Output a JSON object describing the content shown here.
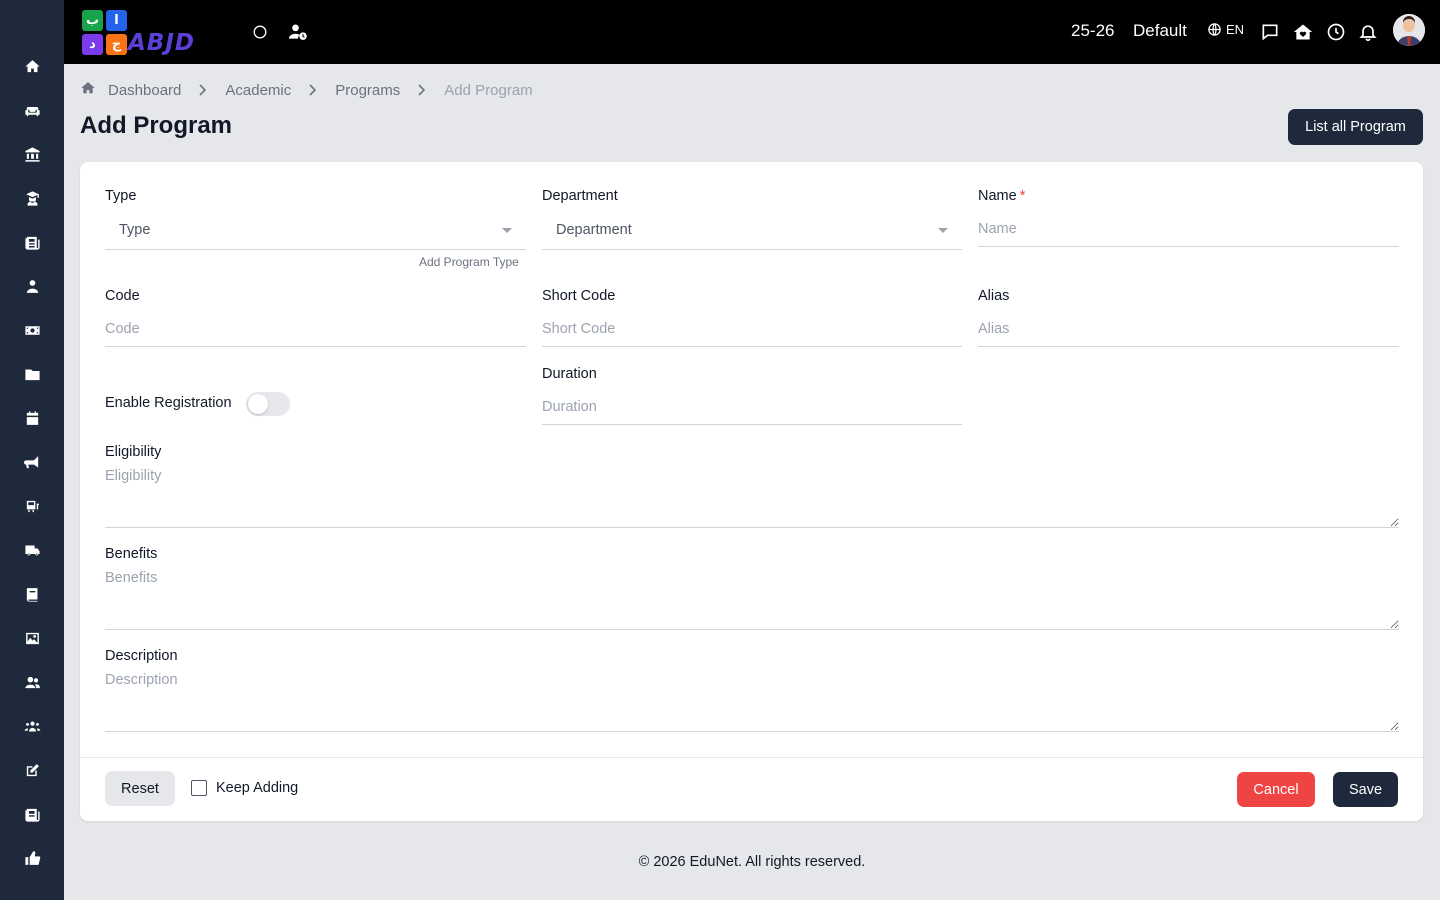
{
  "topbar": {
    "logo_word": "ABJD",
    "logo_tiles": [
      "ب",
      "ا",
      "ج",
      "د"
    ],
    "session": "25-26",
    "theme": "Default",
    "language": "EN",
    "icons": [
      "circle-icon",
      "user-clock-icon",
      "globe-icon",
      "chat-icon",
      "home-heart-icon",
      "clock-icon",
      "bell-icon"
    ]
  },
  "sidebar": {
    "items": [
      "home-icon",
      "sofa-icon",
      "institution-icon",
      "graduate-icon",
      "newspaper-icon",
      "user-icon",
      "money-icon",
      "folder-icon",
      "calendar-icon",
      "megaphone-icon",
      "bus-icon",
      "truck-icon",
      "book-icon",
      "image-icon",
      "users-icon",
      "group-icon",
      "edit-icon",
      "news-icon",
      "thumbs-up-icon"
    ]
  },
  "breadcrumb": {
    "items": [
      "Dashboard",
      "Academic",
      "Programs",
      "Add Program"
    ]
  },
  "page": {
    "title": "Add Program",
    "list_button": "List all Program"
  },
  "form": {
    "type": {
      "label": "Type",
      "value": "Type",
      "helper": "Add Program Type"
    },
    "department": {
      "label": "Department",
      "value": "Department"
    },
    "name": {
      "label": "Name",
      "required_mark": "*",
      "placeholder": "Name"
    },
    "code": {
      "label": "Code",
      "placeholder": "Code"
    },
    "short_code": {
      "label": "Short Code",
      "placeholder": "Short Code"
    },
    "alias": {
      "label": "Alias",
      "placeholder": "Alias"
    },
    "enable_registration": {
      "label": "Enable Registration",
      "checked": false
    },
    "duration": {
      "label": "Duration",
      "placeholder": "Duration"
    },
    "eligibility": {
      "label": "Eligibility",
      "placeholder": "Eligibility"
    },
    "benefits": {
      "label": "Benefits",
      "placeholder": "Benefits"
    },
    "description": {
      "label": "Description",
      "placeholder": "Description"
    }
  },
  "actions": {
    "reset": "Reset",
    "keep_adding": "Keep Adding",
    "cancel": "Cancel",
    "save": "Save"
  },
  "footer": {
    "text": "© 2026 EduNet. All rights reserved."
  },
  "colors": {
    "sidebar": "#1e293b",
    "topbar": "#000000",
    "primary": "#1e293b",
    "danger": "#ef4444",
    "background": "#e5e7eb"
  }
}
